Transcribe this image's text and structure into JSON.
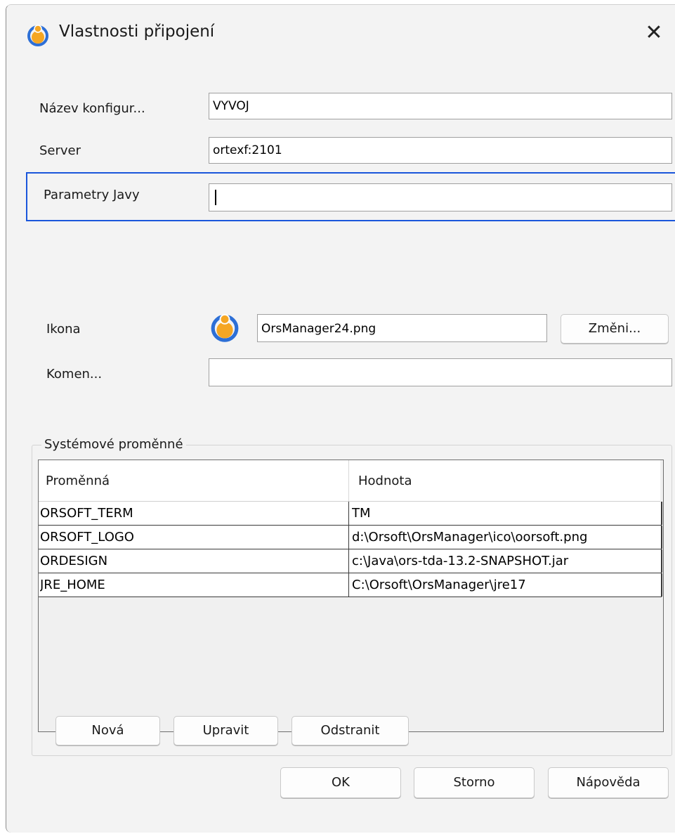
{
  "window": {
    "title": "Vlastnosti připojení"
  },
  "form": {
    "config_name": {
      "label": "Název konfigur...",
      "value": "VYVOJ"
    },
    "server": {
      "label": "Server",
      "value": "ortexf:2101"
    },
    "java_params": {
      "label": "Parametry Javy",
      "value": ""
    },
    "icon": {
      "label": "Ikona",
      "value": "OrsManager24.png",
      "change_label": "Změni..."
    },
    "comment": {
      "label": "Komen...",
      "value": ""
    }
  },
  "env_vars": {
    "group_title": "Systémové proměnné",
    "columns": [
      "Proměnná",
      "Hodnota"
    ],
    "rows": [
      {
        "name": "ORSOFT_TERM",
        "value": "TM"
      },
      {
        "name": "ORSOFT_LOGO",
        "value": "d:\\Orsoft\\OrsManager\\ico\\oorsoft.png"
      },
      {
        "name": "ORDESIGN",
        "value": "c:\\Java\\ors-tda-13.2-SNAPSHOT.jar"
      },
      {
        "name": "JRE_HOME",
        "value": "C:\\Orsoft\\OrsManager\\jre17"
      }
    ],
    "buttons": {
      "new": "Nová",
      "edit": "Upravit",
      "remove": "Odstranit"
    }
  },
  "dialog_buttons": {
    "ok": "OK",
    "cancel": "Storno",
    "help": "Nápověda"
  },
  "icons": {
    "app": "orsmanager-logo-icon",
    "close": "close-icon"
  },
  "colors": {
    "focus_border": "#1a56db",
    "logo_orange": "#f5a623",
    "logo_blue": "#2d6fd6"
  }
}
